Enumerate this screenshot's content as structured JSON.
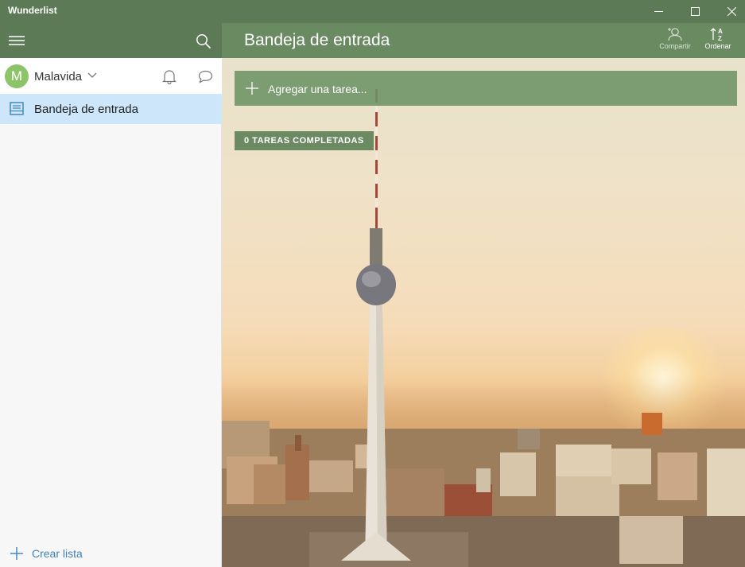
{
  "window": {
    "title": "Wunderlist",
    "controls": [
      "minimize-icon",
      "maximize-icon",
      "close-icon"
    ]
  },
  "sidebar": {
    "menu_icon": "hamburger-icon",
    "search_icon": "search-icon",
    "user": {
      "initial": "M",
      "name": "Malavida",
      "avatar_color": "#8dc46a"
    },
    "notifications_icon": "bell-icon",
    "activity_icon": "chat-bubble-icon",
    "lists": [
      {
        "label": "Bandeja de entrada",
        "icon": "inbox-icon",
        "selected": true
      }
    ],
    "create_list_label": "Crear lista"
  },
  "main": {
    "title": "Bandeja de entrada",
    "share_label": "Compartir",
    "sort_label": "Ordenar",
    "add_task_placeholder": "Agregar una tarea...",
    "completed_label": "0 TAREAS COMPLETADAS"
  },
  "colors": {
    "header_green": "#5c7a56",
    "selected_list": "#cde6fa",
    "link_blue": "#3e82b8"
  }
}
